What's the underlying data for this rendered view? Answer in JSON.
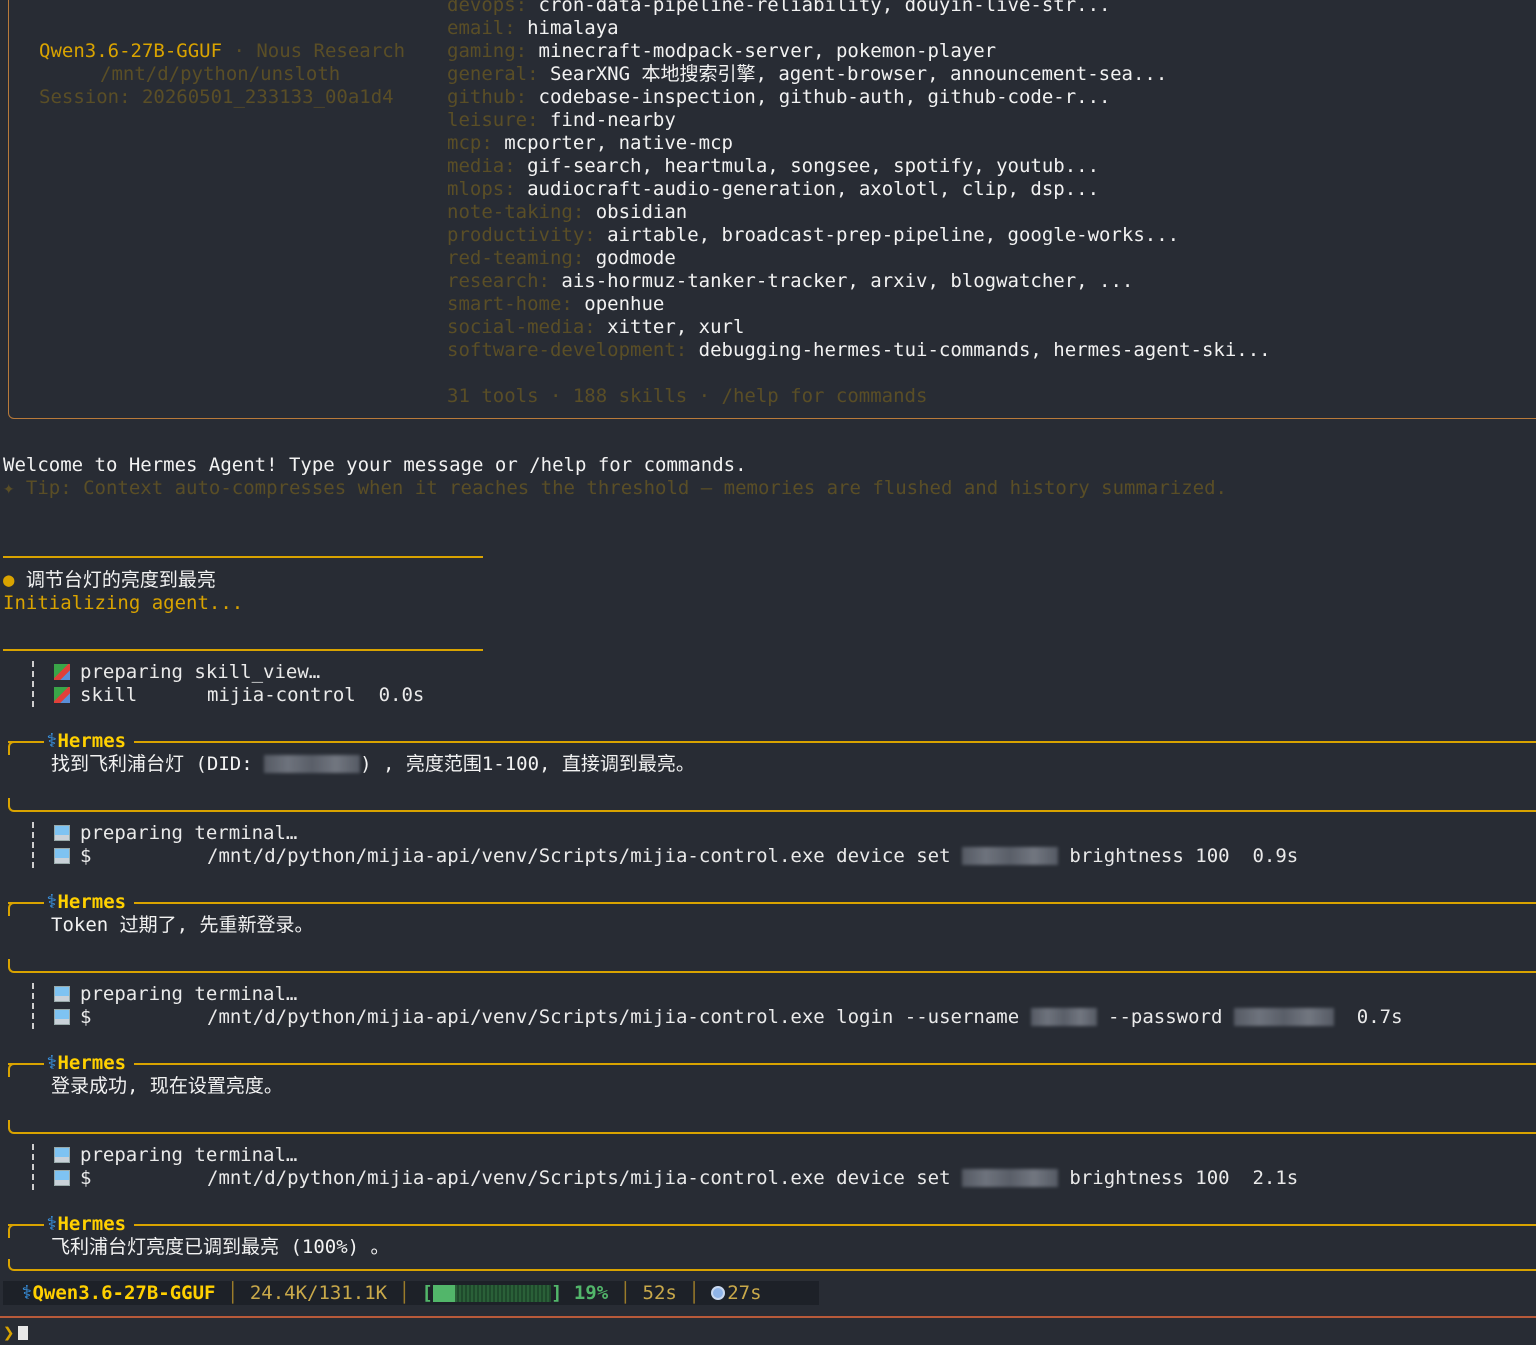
{
  "banner": {
    "model": "Qwen3.6-27B-GGUF",
    "provider_sep": " · ",
    "provider": "Nous Research",
    "cwd": "/mnt/d/python/unsloth",
    "session_label": "Session: 20260501_233133_00a1d4",
    "skills": [
      {
        "category": "devops:",
        "items": "cron-data-pipeline-reliability, douyin-live-str..."
      },
      {
        "category": "email:",
        "items": "himalaya"
      },
      {
        "category": "gaming:",
        "items": "minecraft-modpack-server, pokemon-player"
      },
      {
        "category": "general:",
        "items": "SearXNG 本地搜索引擎, agent-browser, announcement-sea..."
      },
      {
        "category": "github:",
        "items": "codebase-inspection, github-auth, github-code-r..."
      },
      {
        "category": "leisure:",
        "items": "find-nearby"
      },
      {
        "category": "mcp:",
        "items": "mcporter, native-mcp"
      },
      {
        "category": "media:",
        "items": "gif-search, heartmula, songsee, spotify, youtub..."
      },
      {
        "category": "mlops:",
        "items": "audiocraft-audio-generation, axolotl, clip, dsp..."
      },
      {
        "category": "note-taking:",
        "items": "obsidian"
      },
      {
        "category": "productivity:",
        "items": "airtable, broadcast-prep-pipeline, google-works..."
      },
      {
        "category": "red-teaming:",
        "items": "godmode"
      },
      {
        "category": "research:",
        "items": "ais-hormuz-tanker-tracker, arxiv, blogwatcher, ..."
      },
      {
        "category": "smart-home:",
        "items": "openhue"
      },
      {
        "category": "social-media:",
        "items": "xitter, xurl"
      },
      {
        "category": "software-development:",
        "items": "debugging-hermes-tui-commands, hermes-agent-ski..."
      }
    ],
    "footer": "31 tools · 188 skills · /help for commands"
  },
  "welcome": "Welcome to Hermes Agent! Type your message or /help for commands.",
  "tip": "✦ Tip: Context auto-compresses when it reaches the threshold — memories are flushed and history summarized.",
  "user_message": "● 调节台灯的亮度到最亮",
  "initializing": "Initializing agent...",
  "tool_block_1": {
    "line1_label": "preparing",
    "line1_value": "skill_view…",
    "line2_label": "skill",
    "line2_value": "mijia-control",
    "line2_time": "0.0s"
  },
  "hermes_label": "Hermes",
  "msg1": {
    "before": "找到飞利浦台灯 (DID: ",
    "after": ") , 亮度范围1-100, 直接调到最亮。"
  },
  "tool_block_2": {
    "line1_label": "preparing",
    "line1_value": "terminal…",
    "prompt": "$",
    "cmd_before": "/mnt/d/python/mijia-api/venv/Scripts/mijia-control.exe device set ",
    "cmd_after": " brightness 100",
    "time": "0.9s"
  },
  "msg2": "Token 过期了, 先重新登录。",
  "tool_block_3": {
    "line1_label": "preparing",
    "line1_value": "terminal…",
    "prompt": "$",
    "cmd_before": "/mnt/d/python/mijia-api/venv/Scripts/mijia-control.exe login --username ",
    "cmd_mid": " --password ",
    "time": "0.7s"
  },
  "msg3": "登录成功, 现在设置亮度。",
  "tool_block_4": {
    "line1_label": "preparing",
    "line1_value": "terminal…",
    "prompt": "$",
    "cmd_before": "/mnt/d/python/mijia-api/venv/Scripts/mijia-control.exe device set ",
    "cmd_after": " brightness 100",
    "time": "2.1s"
  },
  "msg4": "飞利浦台灯亮度已调到最亮 (100%) 。",
  "status_bar": {
    "model": "Qwen3.6-27B-GGUF",
    "tokens": "24.4K/131.1K",
    "bracket_open": "[",
    "bracket_close": "]",
    "percent_label": "19%",
    "context_fraction": 0.19,
    "elapsed": "52s",
    "timer": "27s"
  },
  "prompt": "❯"
}
